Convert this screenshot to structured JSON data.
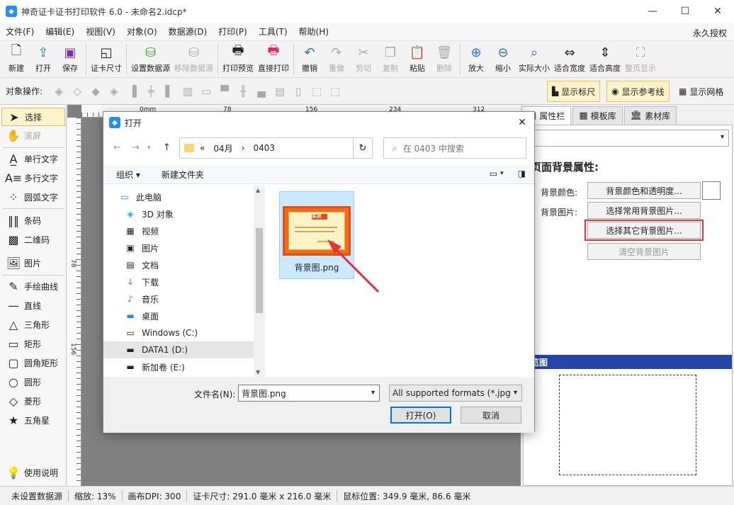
{
  "app": {
    "title": "神奇证卡证书打印软件 6.0 - 未命名2.idcp*",
    "icon_char": "◆"
  },
  "window_controls": {
    "minimize": "—",
    "maximize": "☐",
    "close": "✕"
  },
  "menu": {
    "items": [
      "文件(F)",
      "编辑(E)",
      "视图(V)",
      "对象(O)",
      "数据源(D)",
      "打印(P)",
      "工具(T)",
      "帮助(H)"
    ],
    "right": "永久授权"
  },
  "toolbar": {
    "new": "新建",
    "open": "打开",
    "save": "保存",
    "card_size": "证卡尺寸",
    "set_datasource": "设置数据源",
    "remove_datasource": "移除数据源",
    "print_preview": "打印预览",
    "direct_print": "直接打印",
    "undo": "撤销",
    "redo": "重做",
    "cut": "剪切",
    "copy": "复制",
    "paste": "粘贴",
    "delete": "删除",
    "zoom_in": "放大",
    "zoom_out": "缩小",
    "actual_size": "实际大小",
    "fit_width": "适合宽度",
    "fit_height": "适合高度",
    "whole_page": "整页显示"
  },
  "objbar": {
    "label": "对象操作:",
    "show_ruler": "显示标尺",
    "show_guides": "显示参考线",
    "show_grid": "显示网格"
  },
  "palette": {
    "select": "选择",
    "scroll": "滚屏",
    "single_text": "单行文字",
    "multi_text": "多行文字",
    "arc_text": "圆弧文字",
    "barcode": "条码",
    "qrcode": "二维码",
    "image": "图片",
    "freehand": "手绘曲线",
    "line": "直线",
    "triangle": "三角形",
    "rect": "矩形",
    "round_rect": "圆角矩形",
    "circle": "圆形",
    "diamond": "菱形",
    "star": "五角星",
    "help": "使用说明"
  },
  "ruler": {
    "h_ticks": [
      "0mm",
      "78",
      "156",
      "234",
      "312"
    ],
    "v_ticks": [
      "78",
      "156"
    ]
  },
  "right_panel": {
    "tabs": [
      "属性栏",
      "模板库",
      "素材库"
    ],
    "section_title": "页面背景属性:",
    "bg_color_label": "背景颜色:",
    "bg_color_btn": "背景颜色和透明度...",
    "bg_image_label": "背景图片:",
    "common_bg_btn": "选择常用背景图片...",
    "other_bg_btn": "选择其它背景图片...",
    "clear_bg_btn": "清空背景图片",
    "preview_title": "览图"
  },
  "status": {
    "datasource": "未设置数据源",
    "zoom": "缩放: 13%",
    "dpi": "画布DPI: 300",
    "card_size": "证卡尺寸: 291.0 毫米 x 216.0 毫米",
    "mouse_pos": "鼠标位置: 349.9 毫米, 86.6 毫米"
  },
  "dialog": {
    "title": "打开",
    "close": "✕",
    "breadcrumb": [
      "«",
      "04月",
      "›",
      "0403"
    ],
    "search_placeholder": "在 0403 中搜索",
    "organize": "组织 ▾",
    "new_folder": "新建文件夹",
    "tree": [
      {
        "label": "此电脑",
        "icon": "▭"
      },
      {
        "label": "3D 对象",
        "icon": "◈"
      },
      {
        "label": "视频",
        "icon": "▦"
      },
      {
        "label": "图片",
        "icon": "▣"
      },
      {
        "label": "文档",
        "icon": "▤"
      },
      {
        "label": "下载",
        "icon": "↓"
      },
      {
        "label": "音乐",
        "icon": "♪"
      },
      {
        "label": "桌面",
        "icon": "▬"
      },
      {
        "label": "Windows (C:)",
        "icon": "▭"
      },
      {
        "label": "DATA1 (D:)",
        "icon": "▬"
      },
      {
        "label": "新加卷 (E:)",
        "icon": "▬"
      }
    ],
    "file": {
      "name": "背景图.png",
      "thumb_title": "奖状"
    },
    "filename_label": "文件名(N):",
    "filename_value": "背景图.png",
    "file_type": "All supported formats (*.jpg",
    "open_btn": "打开(O)",
    "cancel_btn": "取消"
  }
}
